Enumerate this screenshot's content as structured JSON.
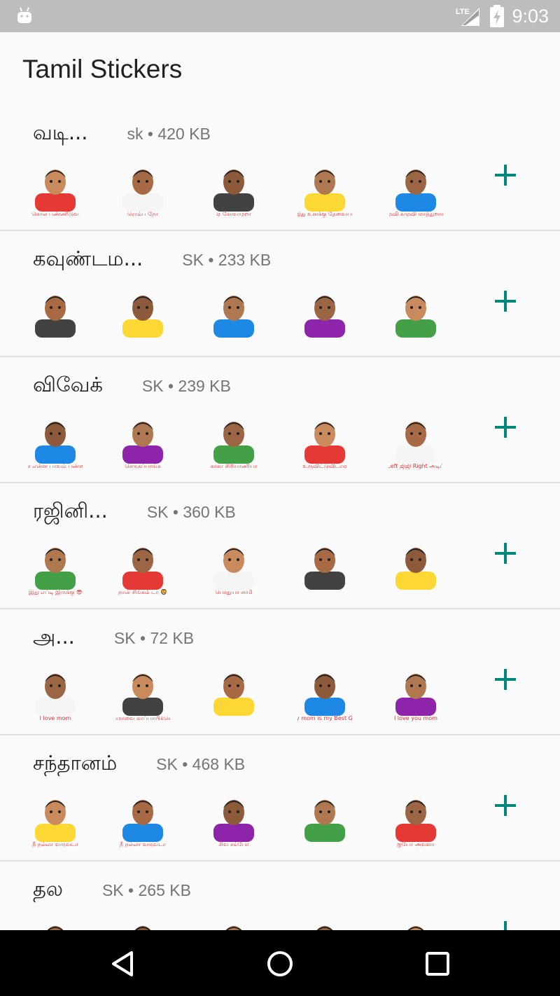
{
  "status_bar": {
    "time": "9:03",
    "network": "LTE",
    "icons": [
      "android-notification-icon",
      "signal-icon",
      "battery-charging-icon"
    ]
  },
  "app": {
    "title": "Tamil Stickers"
  },
  "packs": [
    {
      "name": "வடி...",
      "meta": "sk • 420 KB",
      "sticker_captions": [
        "கொல பண்ணிடுவ",
        "ரொம்ப நோ",
        "ஏ கோவமுறா",
        "இது உனக்கு தேவையா",
        "சுமுவி சுமுவி மாத்துறாங்க"
      ]
    },
    {
      "name": "கவுண்டம...",
      "meta": "SK • 233 KB",
      "sticker_captions": [
        "",
        "",
        "",
        "",
        ""
      ]
    },
    {
      "name": "விவேக்",
      "meta": "SK • 239 KB",
      "sticker_captions": [
        "நா என்ன பாவம் பண்ண",
        "செருகப்பாங்க",
        "காகா சிரியாணியா",
        "உருவிட்டுவிடாம",
        "Left ஜிஜி Right அடிப்"
      ]
    },
    {
      "name": "ரஜினி...",
      "meta": "SK • 360 KB",
      "sticker_captions": [
        "இது எப்டி இருக்கு 😎",
        "நான் சிங்கம் டா 🦁",
        "பொதுயா சாமி",
        "",
        ""
      ]
    },
    {
      "name": "அ...",
      "meta": "SK • 72 KB",
      "sticker_captions": [
        "I love mom",
        "அம்மாவை காப்பாயிக்கொள்",
        "",
        "My mom is my Best Gift",
        "I love you mom"
      ]
    },
    {
      "name": "சந்தானம்",
      "meta": "SK • 468 KB",
      "sticker_captions": [
        "நீ நல்லா வருவடா",
        "நீ நல்லா வருவடா",
        "சிவ சம்போ",
        "",
        "ஐயோ அவளா"
      ]
    },
    {
      "name": "தல",
      "meta": "SK • 265 KB",
      "sticker_captions": [
        "",
        "",
        "",
        "",
        ""
      ]
    }
  ],
  "colors": {
    "accent": "#00897b",
    "status_bar": "#bdbdbd",
    "nav_bar": "#000000",
    "caption_red": "#d32f2f"
  },
  "nav": {
    "back": "back-icon",
    "home": "home-icon",
    "recents": "recents-icon"
  }
}
